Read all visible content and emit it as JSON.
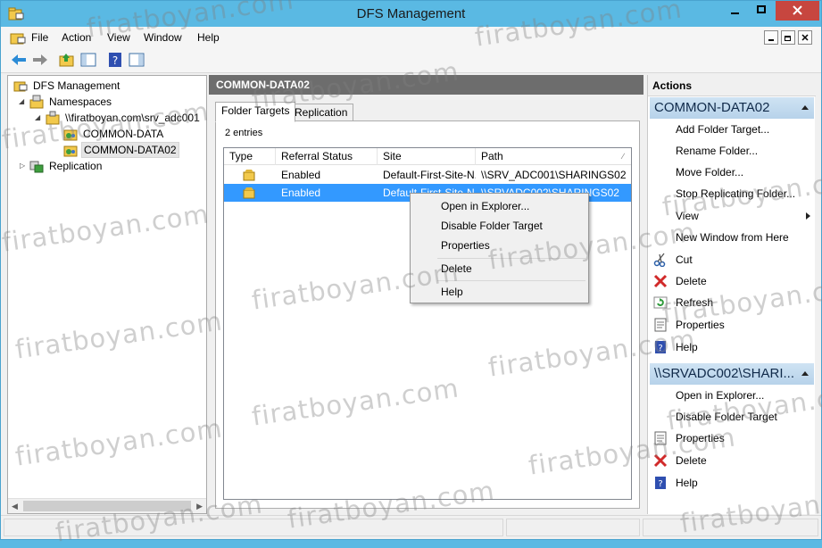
{
  "window": {
    "title": "DFS Management"
  },
  "menubar": [
    "File",
    "Action",
    "View",
    "Window",
    "Help"
  ],
  "toolbar": {
    "icons": [
      "back-arrow-icon",
      "forward-arrow-icon",
      "up-folder-icon",
      "show-hide-tree-icon",
      "help-icon",
      "show-hide-action-pane-icon"
    ]
  },
  "tree": {
    "root": "DFS Management",
    "namespaces": "Namespaces",
    "namespace_server": "\\\\firatboyan.com\\srv_adc001",
    "folders": [
      "COMMON-DATA",
      "COMMON-DATA02"
    ],
    "replication": "Replication"
  },
  "center": {
    "header": "COMMON-DATA02",
    "tabs": [
      "Folder Targets",
      "Replication"
    ],
    "entries": "2 entries",
    "columns": [
      "Type",
      "Referral Status",
      "Site",
      "Path"
    ],
    "rows": [
      {
        "status": "Enabled",
        "site": "Default-First-Site-N...",
        "path": "\\\\SRV_ADC001\\SHARINGS02"
      },
      {
        "status": "Enabled",
        "site": "Default-First-Site-N...",
        "path": "\\\\SRVADC002\\SHARINGS02"
      }
    ]
  },
  "context_menu": {
    "items": [
      "Open in Explorer...",
      "Disable Folder Target",
      "Properties",
      "Delete",
      "Help"
    ]
  },
  "actions": {
    "title": "Actions",
    "section1_header": "COMMON-DATA02",
    "section1_items": [
      {
        "label": "Add Folder Target...",
        "icon": ""
      },
      {
        "label": "Rename Folder...",
        "icon": ""
      },
      {
        "label": "Move Folder...",
        "icon": ""
      },
      {
        "label": "Stop Replicating Folder...",
        "icon": ""
      },
      {
        "label": "View",
        "icon": ""
      },
      {
        "label": "New Window from Here",
        "icon": ""
      },
      {
        "label": "Cut",
        "icon": "scissors-icon"
      },
      {
        "label": "Delete",
        "icon": "delete-x-icon"
      },
      {
        "label": "Refresh",
        "icon": "refresh-icon"
      },
      {
        "label": "Properties",
        "icon": "properties-icon"
      },
      {
        "label": "Help",
        "icon": "help-icon"
      }
    ],
    "section2_header": "\\\\SRVADC002\\SHARI...",
    "section2_items": [
      {
        "label": "Open in Explorer...",
        "icon": ""
      },
      {
        "label": "Disable Folder Target",
        "icon": ""
      },
      {
        "label": "Properties",
        "icon": "properties-icon"
      },
      {
        "label": "Delete",
        "icon": "delete-x-icon"
      },
      {
        "label": "Help",
        "icon": "help-icon"
      }
    ]
  },
  "watermark": "firatboyan.com",
  "colors": {
    "titlebar": "#5ab9e3",
    "selection": "#3399ff",
    "close_button": "#c7463f",
    "center_header": "#6d6d6d"
  }
}
